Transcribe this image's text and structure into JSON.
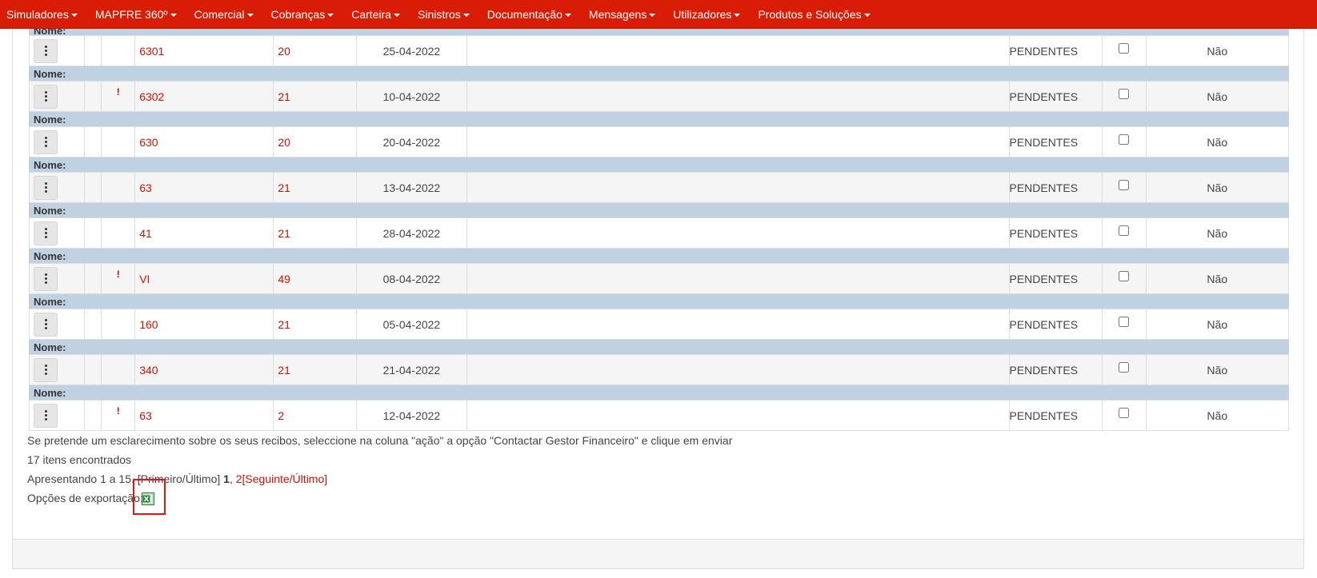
{
  "nav": {
    "items": [
      "Simuladores",
      "MAPFRE 360º",
      "Comercial",
      "Cobranças",
      "Carteira",
      "Sinistros",
      "Documentação",
      "Mensagens",
      "Utilizadores",
      "Produtos e Soluções"
    ]
  },
  "table": {
    "name_label": "Nome:",
    "rows": [
      {
        "warn": "",
        "code": "6301",
        "num": "20",
        "date": "25-04-2022",
        "status": "PENDENTES",
        "flag": "Não"
      },
      {
        "warn": "!",
        "code": "6302",
        "num": "21",
        "date": "10-04-2022",
        "status": "PENDENTES",
        "flag": "Não"
      },
      {
        "warn": "",
        "code": "630",
        "num": "20",
        "date": "20-04-2022",
        "status": "PENDENTES",
        "flag": "Não"
      },
      {
        "warn": "",
        "code": "63",
        "num": "21",
        "date": "13-04-2022",
        "status": "PENDENTES",
        "flag": "Não"
      },
      {
        "warn": "",
        "code": "41",
        "num": "21",
        "date": "28-04-2022",
        "status": "PENDENTES",
        "flag": "Não"
      },
      {
        "warn": "!",
        "code": "VI",
        "num": "49",
        "date": "08-04-2022",
        "status": "PENDENTES",
        "flag": "Não"
      },
      {
        "warn": "",
        "code": "160",
        "num": "21",
        "date": "05-04-2022",
        "status": "PENDENTES",
        "flag": "Não"
      },
      {
        "warn": "",
        "code": "340",
        "num": "21",
        "date": "21-04-2022",
        "status": "PENDENTES",
        "flag": "Não"
      },
      {
        "warn": "!",
        "code": "63",
        "num": "2",
        "date": "12-04-2022",
        "status": "PENDENTES",
        "flag": "Não"
      }
    ]
  },
  "footer": {
    "hint": "Se pretende um esclarecimento sobre os seus recibos, seleccione na coluna \"ação\" a opção \"Contactar Gestor Financeiro\" e clique em enviar",
    "items_found": "17 itens encontrados",
    "showing_prefix": "Apresentando 1 a 15. [",
    "first_link": "Primeiro",
    "slash1": "/",
    "last_link_plain": "Último",
    "close_bracket": "] ",
    "page_current": "1",
    "comma": ", ",
    "page_2": "2",
    "open_bracket": "[",
    "next_link": "Seguinte",
    "slash2": "/",
    "last_link": "Último",
    "close_bracket2": "]",
    "export_label": "Opções de exportação:"
  },
  "colors": {
    "navbar": "#d91c05",
    "link_red": "#cc1100",
    "name_row": "#c0d1e1",
    "highlight": "#ee1111"
  },
  "icons": {
    "action": "kebab-vertical-icon",
    "export": "excel-icon"
  }
}
